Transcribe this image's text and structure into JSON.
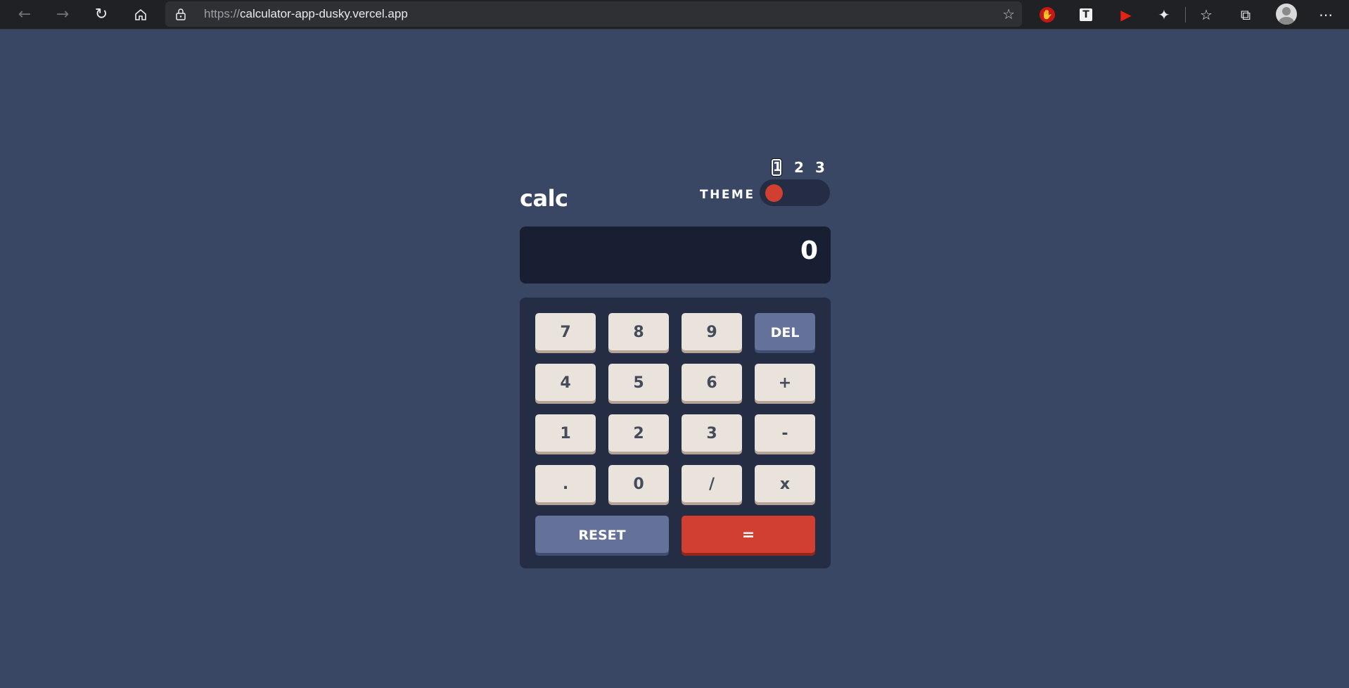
{
  "browser": {
    "url_protocol": "https://",
    "url_host": "calculator-app-dusky.vercel.app",
    "icons": {
      "back": "arrow-left-icon",
      "forward": "arrow-right-icon",
      "refresh": "refresh-icon",
      "home": "home-icon",
      "lock": "lock-icon",
      "favorite_add": "star-plus-icon"
    }
  },
  "calculator": {
    "title": "calc",
    "theme_label": "THEME",
    "theme_options": [
      "1",
      "2",
      "3"
    ],
    "active_theme": 1,
    "display_value": "0",
    "keys": {
      "k7": "7",
      "k8": "8",
      "k9": "9",
      "del": "DEL",
      "k4": "4",
      "k5": "5",
      "k6": "6",
      "plus": "+",
      "k1": "1",
      "k2": "2",
      "k3": "3",
      "minus": "-",
      "dot": ".",
      "k0": "0",
      "divide": "/",
      "multiply": "x",
      "reset": "RESET",
      "equals": "="
    },
    "colors": {
      "background": "#3a4764",
      "keypad": "#242d44",
      "screen": "#181f33",
      "key": "#eae3dc",
      "key_text": "#444b5a",
      "accent_blue": "#647198",
      "accent_red": "#d03f2f"
    }
  }
}
